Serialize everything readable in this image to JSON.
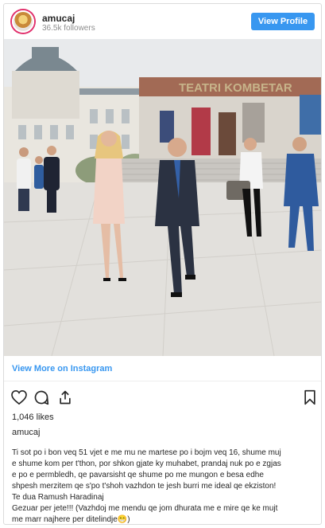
{
  "header": {
    "username": "amucaj",
    "followers": "36.5k followers",
    "view_profile_label": "View Profile"
  },
  "photo": {
    "building_sign": "TEATRI KOMBETAR",
    "accent_color": "#3897f0"
  },
  "footer": {
    "view_more_label": "View More on Instagram",
    "likes": "1,046 likes",
    "author": "amucaj",
    "caption_lines": [
      "Ti sot po i bon veq 51 vjet e me mu ne martese po i bojm veq 16, shume muj",
      "e shume kom per t'thon, por shkon gjate ky muhabet, prandaj nuk po e zgjas",
      "e po e permbledh, qe pavarsisht qe shume po me mungon e besa edhe",
      "shpesh merzitem qe s'po t'shoh vazhdon te jesh burri me ideal qe ekziston!",
      "Te dua Ramush Haradinaj",
      "Gezuar per jete!!! (Vazhdoj me mendu qe jom dhurata me e mire qe ke mujt",
      "me marr najhere per ditelindje😁)"
    ]
  },
  "icons": [
    "heart-icon",
    "comment-icon",
    "share-icon",
    "bookmark-icon"
  ]
}
